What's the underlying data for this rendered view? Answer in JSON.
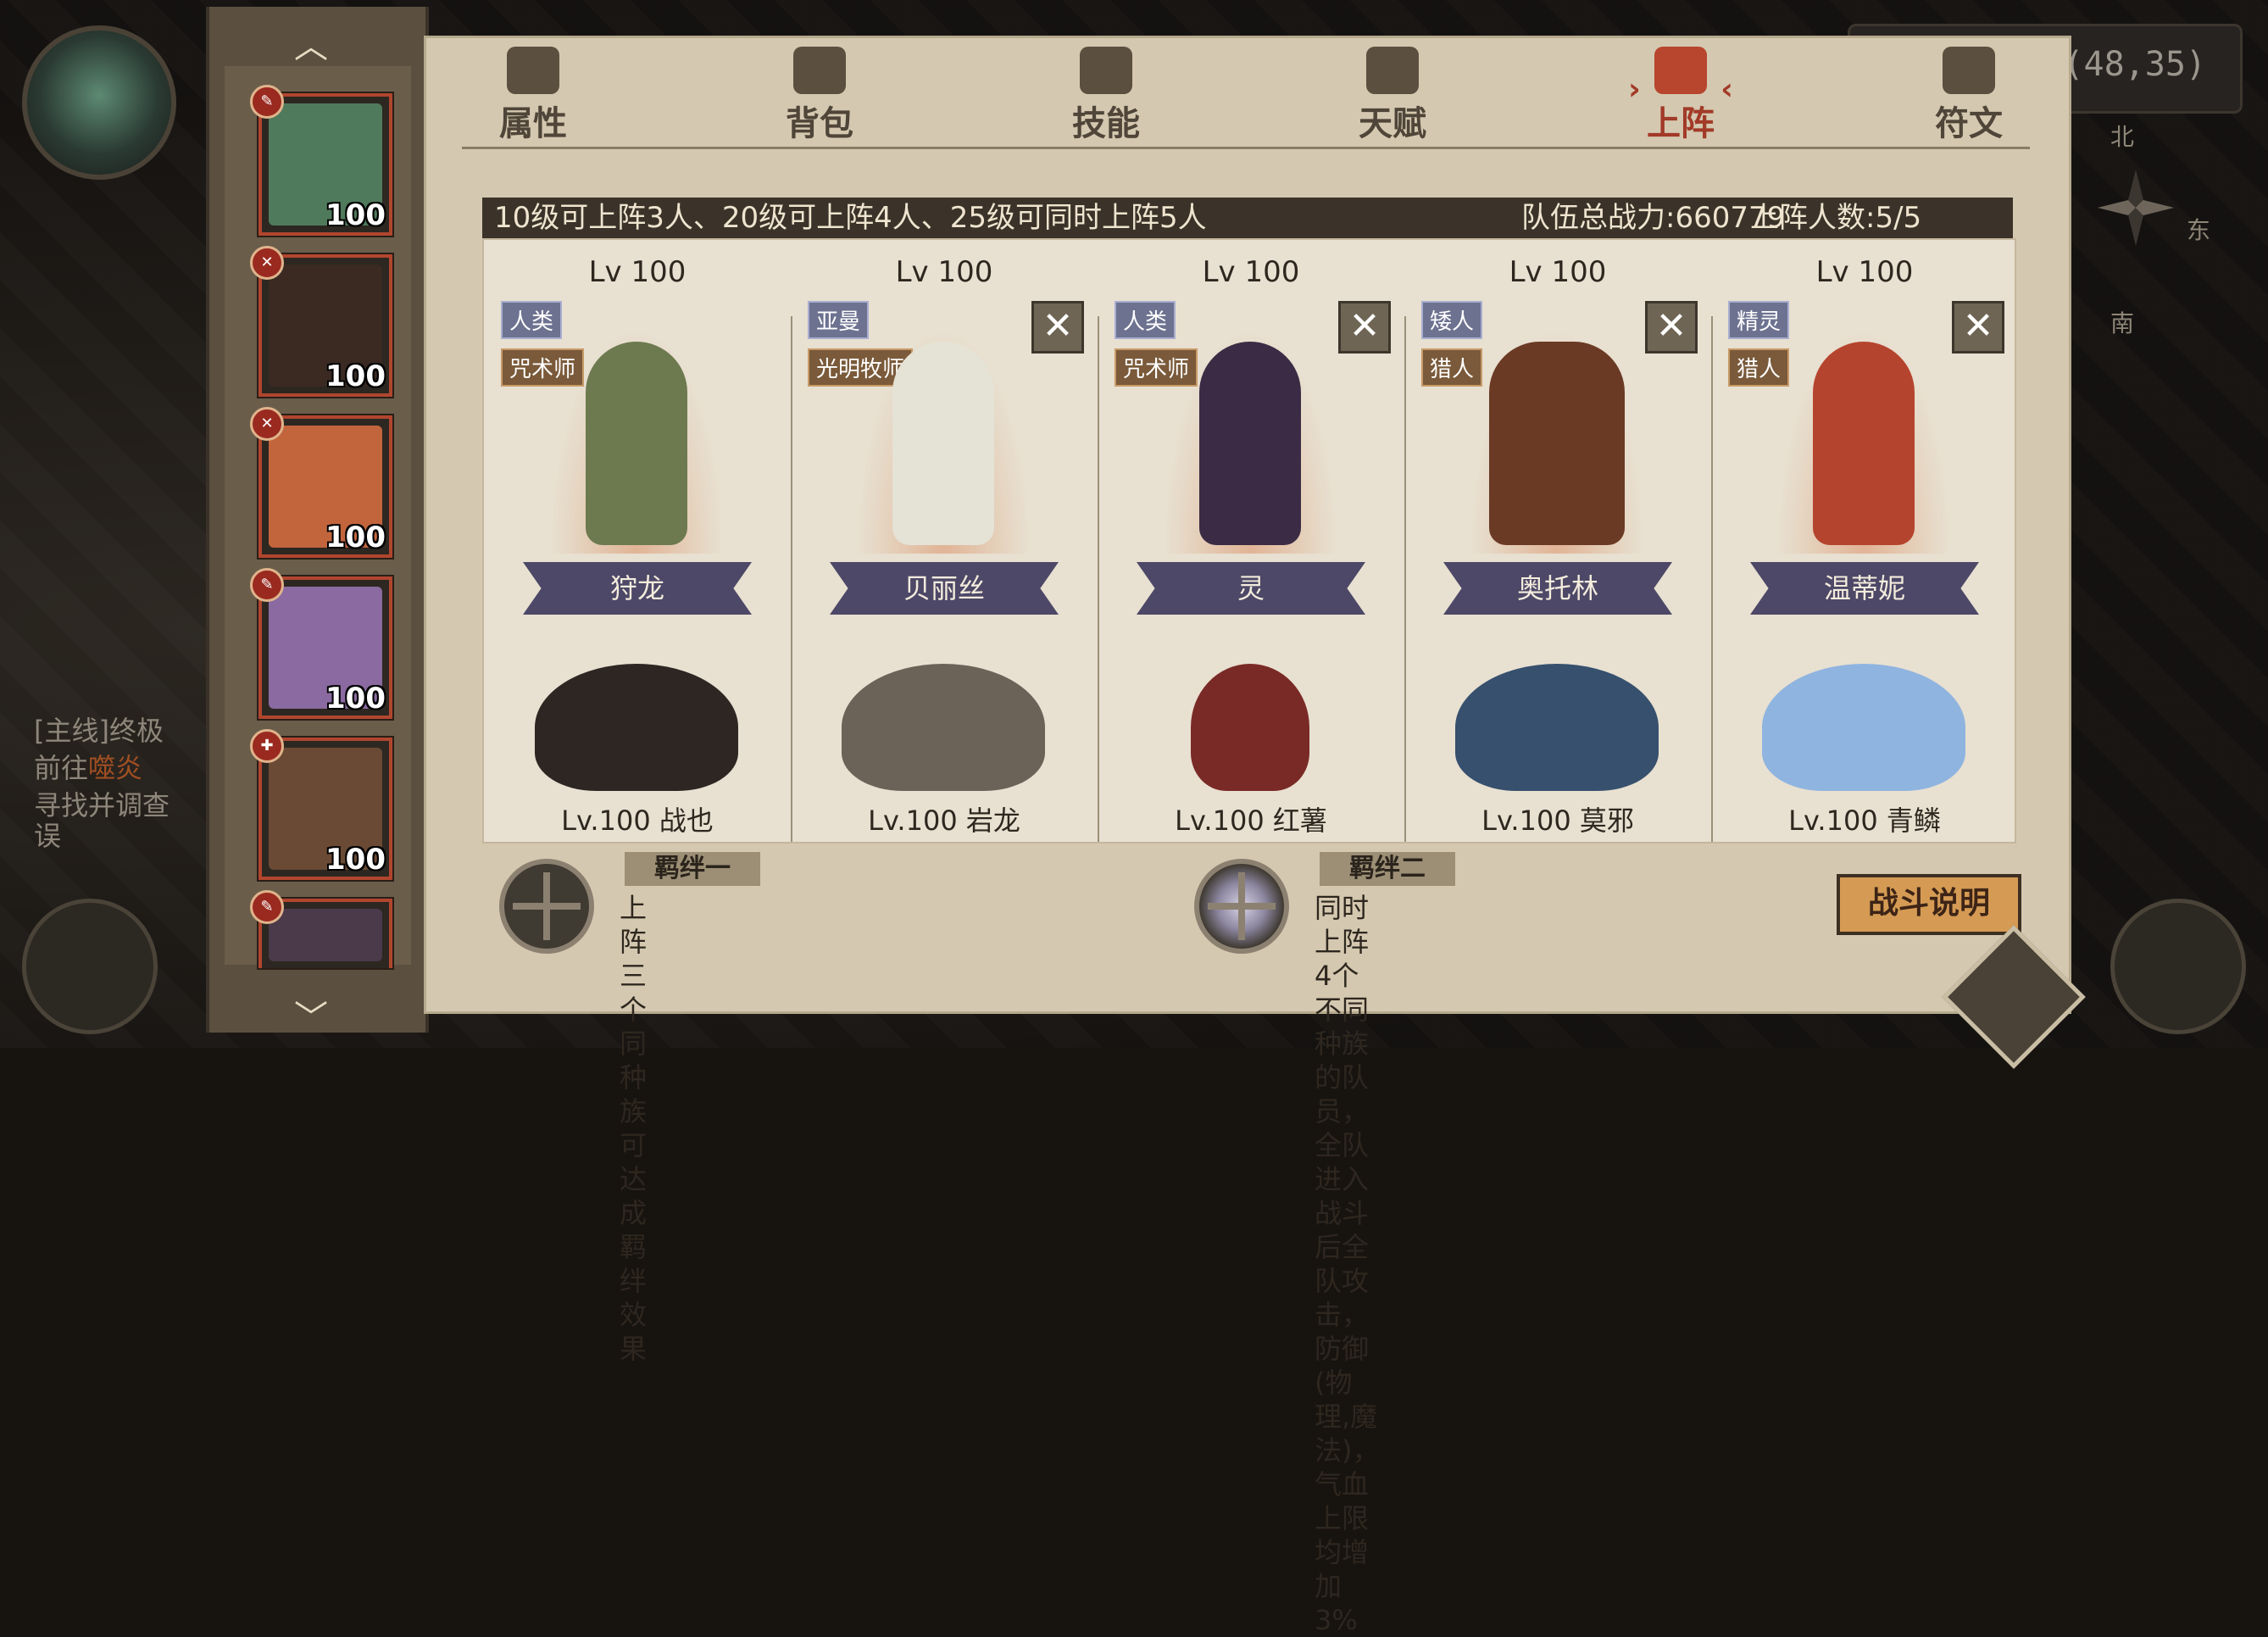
{
  "hud": {
    "coordinates": "(48,35)",
    "compass": {
      "north": "北",
      "east": "东",
      "south": "南"
    },
    "quest": {
      "tag": "[主线]终极",
      "line1_prefix": "前往",
      "line1_highlight": "噬炎",
      "line2": "寻找并调查",
      "line3": "误"
    }
  },
  "tabs": [
    {
      "label": "属性",
      "icon": "flame-icon"
    },
    {
      "label": "背包",
      "icon": "bag-icon"
    },
    {
      "label": "技能",
      "icon": "book-icon"
    },
    {
      "label": "天赋",
      "icon": "eye-icon"
    },
    {
      "label": "上阵",
      "icon": "crossed-swords-icon",
      "active": true
    },
    {
      "label": "符文",
      "icon": "rune-icon"
    }
  ],
  "info": {
    "unlock_text": "10级可上阵3人、20级可上阵4人、25级可同时上阵5人",
    "team_power": "队伍总战力:660779",
    "deploy_count": "上阵人数:5/5"
  },
  "roster": [
    {
      "level": "100",
      "face_color": "#4f7a5c"
    },
    {
      "level": "100",
      "face_color": "#3a2a22"
    },
    {
      "level": "100",
      "face_color": "#c2653d"
    },
    {
      "level": "100",
      "face_color": "#8a6aa0"
    },
    {
      "level": "100",
      "face_color": "#6a4a35"
    },
    {
      "level": "",
      "face_color": "#4a3a4a"
    }
  ],
  "slots": [
    {
      "level": "Lv 100",
      "race": "人类",
      "class": "咒术师",
      "name": "狩龙",
      "pet": "Lv.100 战也",
      "has_remove": false,
      "char_color": "#6d7a4f",
      "pet_color": "#2d2622"
    },
    {
      "level": "Lv 100",
      "race": "亚曼",
      "class": "光明牧师",
      "name": "贝丽丝",
      "pet": "Lv.100 岩龙",
      "has_remove": true,
      "char_color": "#e5e2d6",
      "pet_color": "#6b6258"
    },
    {
      "level": "Lv 100",
      "race": "人类",
      "class": "咒术师",
      "name": "灵",
      "pet": "Lv.100 红薯",
      "has_remove": true,
      "char_color": "#3b2b44",
      "pet_color": "#7a2a26"
    },
    {
      "level": "Lv 100",
      "race": "矮人",
      "class": "猎人",
      "name": "奥托林",
      "pet": "Lv.100 莫邪",
      "has_remove": true,
      "char_color": "#6b3a25",
      "pet_color": "#36506e"
    },
    {
      "level": "Lv 100",
      "race": "精灵",
      "class": "猎人",
      "name": "温蒂妮",
      "pet": "Lv.100 青鳞",
      "has_remove": true,
      "char_color": "#b5442e",
      "pet_color": "#8fb4e0"
    }
  ],
  "bonds": [
    {
      "title": "羁绊一",
      "desc_lines": [
        "上阵三个同种族可达成羁绊效果"
      ]
    },
    {
      "title": "羁绊二",
      "desc_lines": [
        "同时上阵4个不同种族的队员，全队进入",
        "战斗后全队攻击，防御(物理,魔法)，气血",
        "上限均增加3%"
      ]
    }
  ],
  "buttons": {
    "battle_info": "战斗说明",
    "remove": "✕",
    "scroll_up": "︿",
    "scroll_down": "﹀"
  }
}
